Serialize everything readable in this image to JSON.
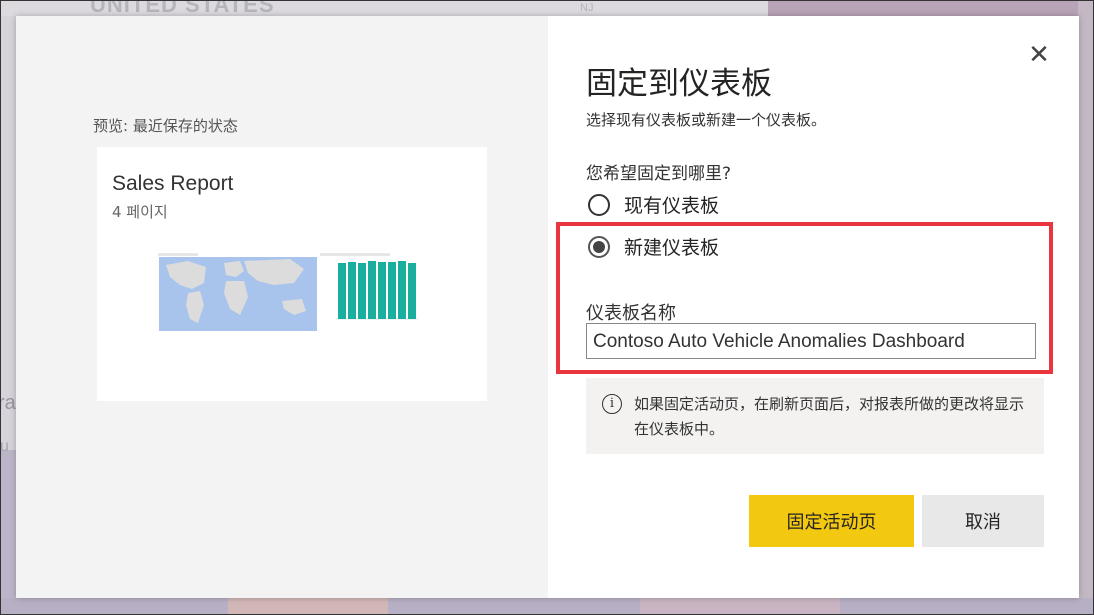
{
  "background": {
    "map_title": "UNITED STATES",
    "map_state": "NJ",
    "left_text_1": "ra",
    "left_text_2": "u"
  },
  "preview": {
    "label": "预览: 最近保存的状态",
    "report_title": "Sales Report",
    "report_pages": "4 페이지"
  },
  "dialog": {
    "title": "固定到仪表板",
    "subtitle": "选择现有仪表板或新建一个仪表板。",
    "question": "您希望固定到哪里?",
    "options": [
      {
        "label": "现有仪表板",
        "selected": false
      },
      {
        "label": "新建仪表板",
        "selected": true
      }
    ],
    "name_label": "仪表板名称",
    "name_value": "Contoso Auto Vehicle Anomalies Dashboard",
    "info_text": "如果固定活动页，在刷新页面后，对报表所做的更改将显示在仪表板中。",
    "close_symbol": "✕",
    "info_symbol": "i",
    "primary_button": "固定活动页",
    "secondary_button": "取消"
  },
  "colors": {
    "primary_button": "#f2c811",
    "highlight": "#e8353e",
    "chart_bars": "#1aae9f"
  }
}
